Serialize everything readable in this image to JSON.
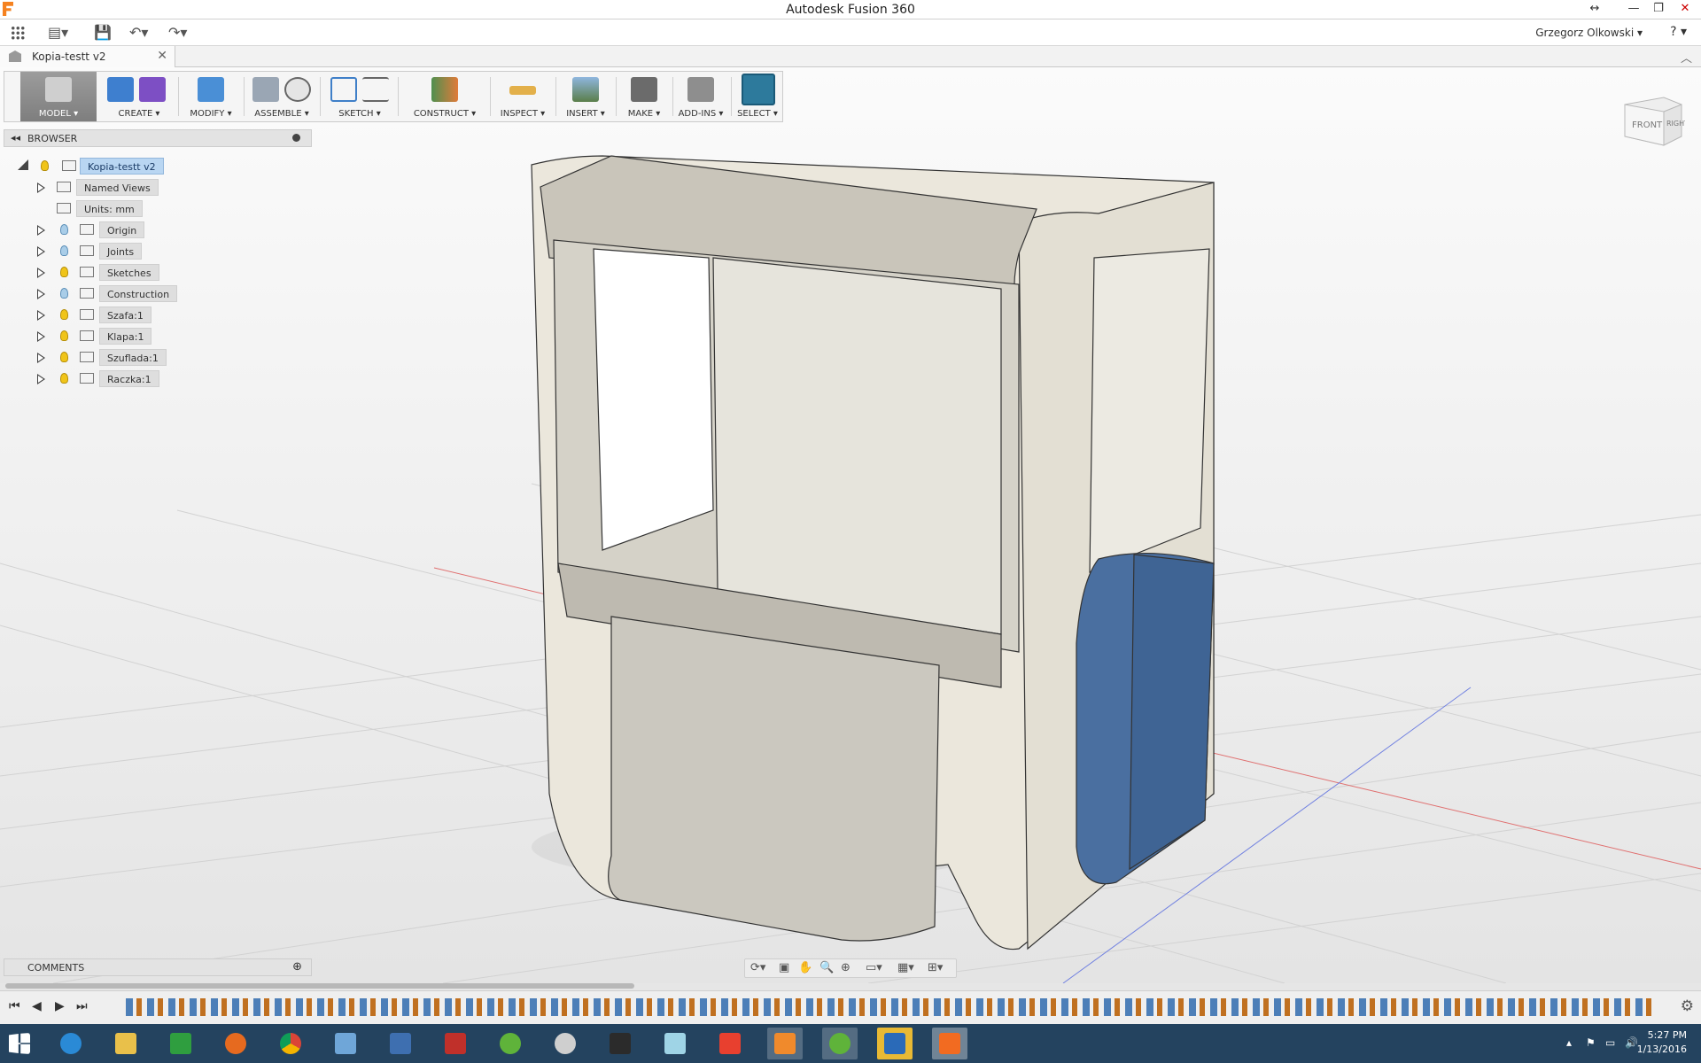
{
  "window": {
    "title": "Autodesk Fusion 360",
    "controls": {
      "resize": "↔",
      "minimize": "—",
      "restore": "❐",
      "close": "✕"
    }
  },
  "qat": {
    "user_name": "Grzegorz Olkowski",
    "help": "?"
  },
  "document_tab": {
    "label": "Kopia-testt v2",
    "close": "✕"
  },
  "ribbon": {
    "groups": [
      {
        "id": "model",
        "label": "MODEL ▾"
      },
      {
        "id": "create",
        "label": "CREATE ▾"
      },
      {
        "id": "modify",
        "label": "MODIFY ▾"
      },
      {
        "id": "assemble",
        "label": "ASSEMBLE ▾"
      },
      {
        "id": "sketch",
        "label": "SKETCH ▾"
      },
      {
        "id": "construct",
        "label": "CONSTRUCT ▾"
      },
      {
        "id": "inspect",
        "label": "INSPECT ▾"
      },
      {
        "id": "insert",
        "label": "INSERT ▾"
      },
      {
        "id": "make",
        "label": "MAKE ▾"
      },
      {
        "id": "addins",
        "label": "ADD-INS ▾"
      },
      {
        "id": "select",
        "label": "SELECT ▾"
      }
    ]
  },
  "browser": {
    "title": "BROWSER",
    "root": "Kopia-testt v2",
    "items": [
      {
        "label": "Named Views",
        "expandable": true,
        "light": false
      },
      {
        "label": "Units: mm",
        "expandable": false,
        "light": false
      },
      {
        "label": "Origin",
        "expandable": true,
        "light": "off"
      },
      {
        "label": "Joints",
        "expandable": true,
        "light": "off"
      },
      {
        "label": "Sketches",
        "expandable": true,
        "light": "on"
      },
      {
        "label": "Construction",
        "expandable": true,
        "light": "off"
      },
      {
        "label": "Szafa:1",
        "expandable": true,
        "light": "on"
      },
      {
        "label": "Klapa:1",
        "expandable": true,
        "light": "on"
      },
      {
        "label": "Szuflada:1",
        "expandable": true,
        "light": "on"
      },
      {
        "label": "Raczka:1",
        "expandable": true,
        "light": "on"
      }
    ]
  },
  "viewcube": {
    "front": "FRONT",
    "right": "RIGHT"
  },
  "comments": {
    "title": "COMMENTS"
  },
  "timeline": {
    "controls": [
      "⏮",
      "◀",
      "▶",
      "⏭"
    ]
  },
  "clock": {
    "time": "5:27 PM",
    "date": "1/13/2016"
  },
  "colors": {
    "accent_blue": "#4a6fa0",
    "model_body": "#e9e6dc",
    "taskbar": "#24435f"
  }
}
